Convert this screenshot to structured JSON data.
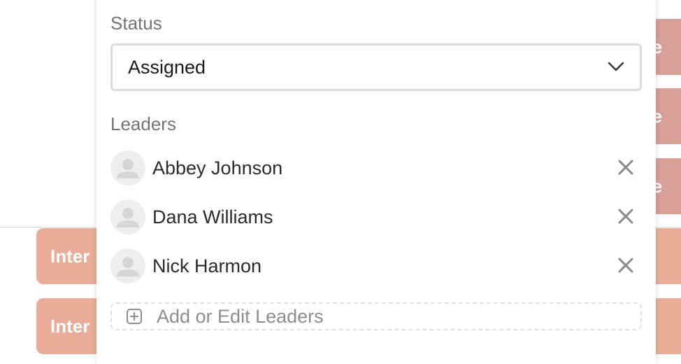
{
  "background": {
    "right_chip_text": "te",
    "left_chip_text": "Inter"
  },
  "status": {
    "label": "Status",
    "selected": "Assigned"
  },
  "leaders": {
    "label": "Leaders",
    "items": [
      {
        "name": "Abbey Johnson"
      },
      {
        "name": "Dana Williams"
      },
      {
        "name": "Nick Harmon"
      }
    ],
    "add_label": "Add or Edit Leaders"
  },
  "icons": {
    "chevron": "chevron-down-icon",
    "avatar": "user-avatar-icon",
    "remove": "close-icon",
    "add": "plus-square-icon"
  }
}
